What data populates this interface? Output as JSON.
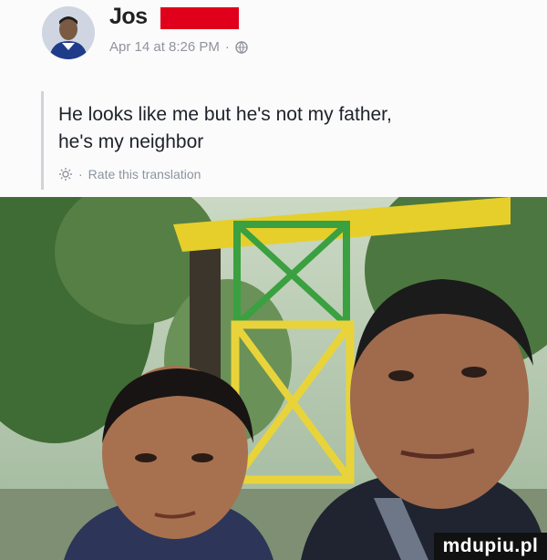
{
  "post": {
    "author_name": "Jos",
    "timestamp": "Apr 14 at 8:26 PM",
    "separator": "·",
    "privacy_icon": "globe-icon",
    "text_line1": "He looks like me but he's not my father,",
    "text_line2": "he's my neighbor",
    "rate_translation": "Rate this translation",
    "rate_separator": "·",
    "translation_icon": "gear-icon"
  },
  "watermark": {
    "text": "mdupiu.pl"
  },
  "colors": {
    "redaction": "#e0001b",
    "meta_text": "#90949c",
    "body_text": "#1d2129"
  }
}
